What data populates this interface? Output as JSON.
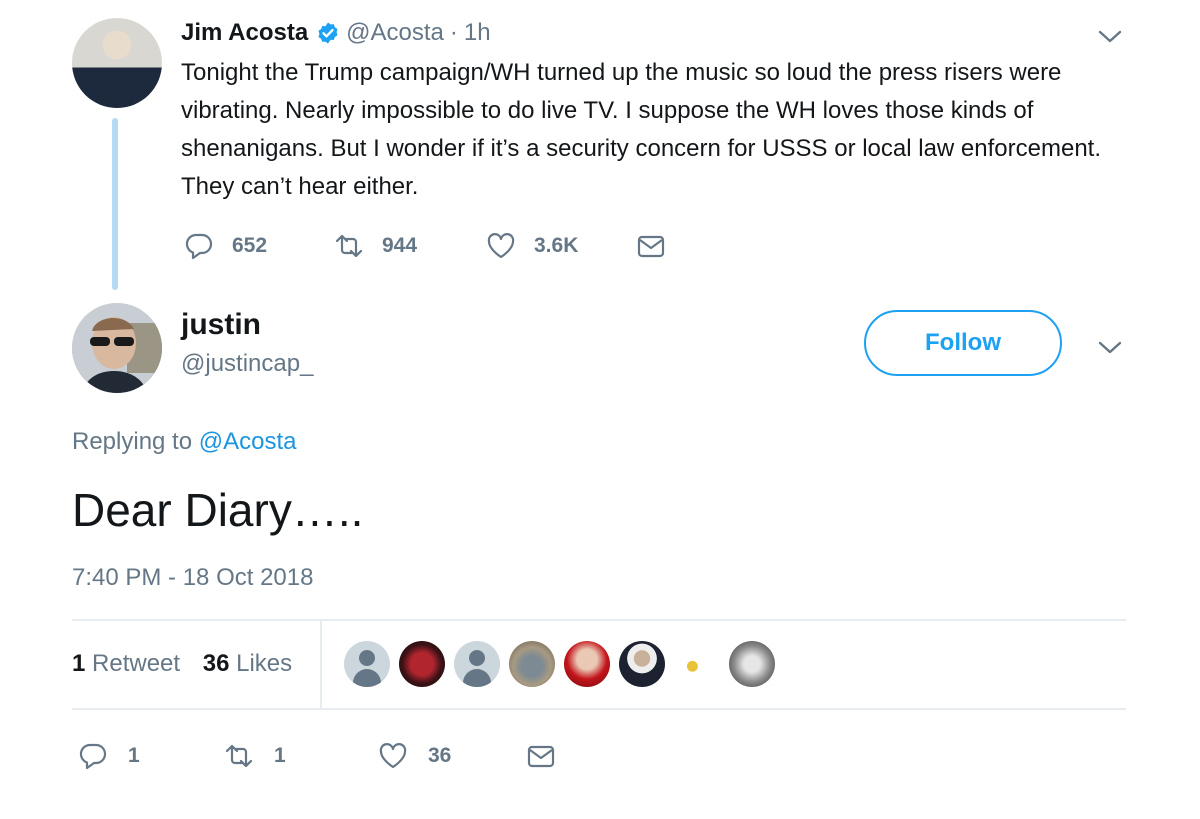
{
  "parent_tweet": {
    "name": "Jim Acosta",
    "handle": "@Acosta",
    "separator": "·",
    "time": "1h",
    "text": "Tonight the Trump campaign/WH turned up the music so loud the press risers were vibrating. Nearly impossible to do live TV. I suppose the WH loves those kinds of shenanigans. But I wonder if it’s a security concern for USSS or local law enforcement. They can’t hear either.",
    "replies": "652",
    "retweets": "944",
    "likes": "3.6K"
  },
  "tweet": {
    "name": "justin",
    "handle": "@justincap_",
    "follow_label": "Follow",
    "replying_prefix": "Replying to",
    "replying_to": "@Acosta",
    "text": "Dear Diary…..",
    "timestamp": "7:40 PM - 18 Oct 2018",
    "retweet_count": "1",
    "retweet_label": "Retweet",
    "like_count": "36",
    "like_label": "Likes",
    "action_replies": "1",
    "action_retweets": "1",
    "action_likes": "36"
  },
  "icons": {
    "verified": "verified-badge-icon",
    "chevron": "chevron-down-icon",
    "reply": "reply-icon",
    "retweet": "retweet-icon",
    "like": "heart-icon",
    "dm": "envelope-icon"
  },
  "colors": {
    "accent": "#1da1f2",
    "link": "#1b95e0",
    "muted": "#657786",
    "text": "#14171a",
    "thread_line": "#b3dbf5",
    "divider": "#e6ecf0"
  }
}
